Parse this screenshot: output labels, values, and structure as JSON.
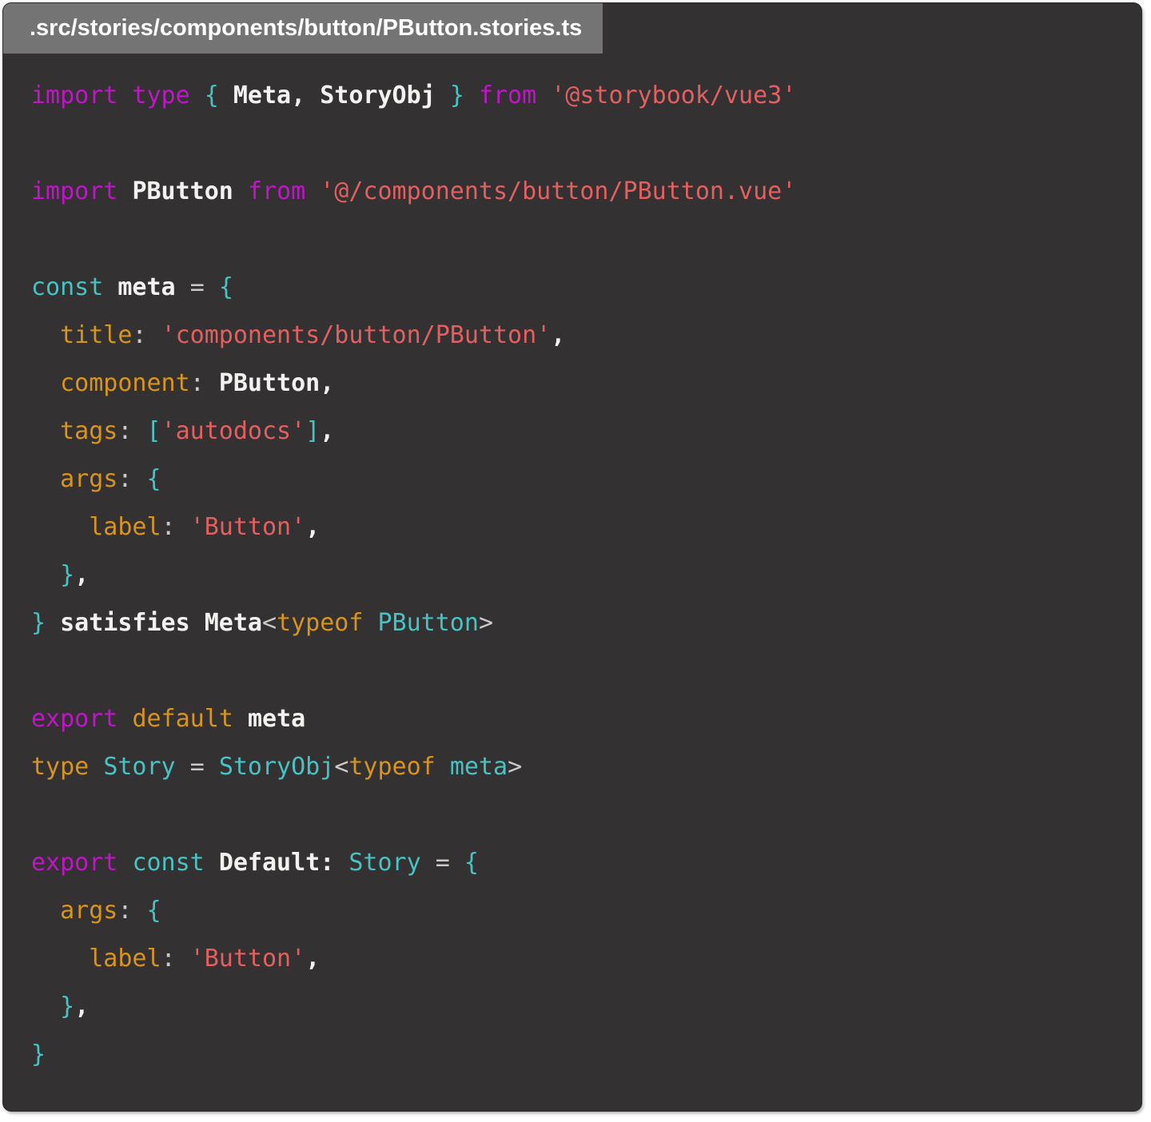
{
  "tab": {
    "filename": ".src/stories/components/button/PButton.stories.ts"
  },
  "colors": {
    "page_bg": "#ffffff",
    "window_bg": "#333132",
    "tab_bg": "#747474",
    "tab_text": "#ffffff",
    "keyword": "#c016c8",
    "cyan": "#48c2c2",
    "orange": "#d9941c",
    "string": "#e26060",
    "bold_text": "#f4f1f1",
    "punct": "#cbcbcb"
  },
  "code": {
    "language": "typescript",
    "lines": [
      [
        {
          "t": "import type ",
          "c": "kw"
        },
        {
          "t": "{ ",
          "c": "cy"
        },
        {
          "t": "Meta, StoryObj ",
          "c": "wb"
        },
        {
          "t": "} ",
          "c": "cy"
        },
        {
          "t": "from ",
          "c": "kw"
        },
        {
          "t": "'@storybook/vue3'",
          "c": "st"
        }
      ],
      [],
      [
        {
          "t": "import ",
          "c": "kw"
        },
        {
          "t": "PButton ",
          "c": "wb"
        },
        {
          "t": "from ",
          "c": "kw"
        },
        {
          "t": "'@/components/button/PButton.vue'",
          "c": "st"
        }
      ],
      [],
      [
        {
          "t": "const ",
          "c": "cy"
        },
        {
          "t": "meta ",
          "c": "wb"
        },
        {
          "t": "= ",
          "c": "pu"
        },
        {
          "t": "{",
          "c": "cy"
        }
      ],
      [
        {
          "t": "  title",
          "c": "or"
        },
        {
          "t": ": ",
          "c": "pu"
        },
        {
          "t": "'components/button/PButton'",
          "c": "st"
        },
        {
          "t": ",",
          "c": "wb"
        }
      ],
      [
        {
          "t": "  component",
          "c": "or"
        },
        {
          "t": ": ",
          "c": "pu"
        },
        {
          "t": "PButton,",
          "c": "wb"
        }
      ],
      [
        {
          "t": "  tags",
          "c": "or"
        },
        {
          "t": ": ",
          "c": "pu"
        },
        {
          "t": "[",
          "c": "cy"
        },
        {
          "t": "'autodocs'",
          "c": "st"
        },
        {
          "t": "]",
          "c": "cy"
        },
        {
          "t": ",",
          "c": "wb"
        }
      ],
      [
        {
          "t": "  args",
          "c": "or"
        },
        {
          "t": ": ",
          "c": "pu"
        },
        {
          "t": "{",
          "c": "cy"
        }
      ],
      [
        {
          "t": "    label",
          "c": "or"
        },
        {
          "t": ": ",
          "c": "pu"
        },
        {
          "t": "'Button'",
          "c": "st"
        },
        {
          "t": ",",
          "c": "wb"
        }
      ],
      [
        {
          "t": "  }",
          "c": "cy"
        },
        {
          "t": ",",
          "c": "wb"
        }
      ],
      [
        {
          "t": "} ",
          "c": "cy"
        },
        {
          "t": "satisfies Meta",
          "c": "wb"
        },
        {
          "t": "<",
          "c": "pu"
        },
        {
          "t": "typeof ",
          "c": "or"
        },
        {
          "t": "PButton",
          "c": "cy"
        },
        {
          "t": ">",
          "c": "pu"
        }
      ],
      [],
      [
        {
          "t": "export ",
          "c": "kw"
        },
        {
          "t": "default ",
          "c": "or"
        },
        {
          "t": "meta",
          "c": "wb"
        }
      ],
      [
        {
          "t": "type ",
          "c": "or"
        },
        {
          "t": "Story ",
          "c": "cy"
        },
        {
          "t": "= ",
          "c": "pu"
        },
        {
          "t": "StoryObj",
          "c": "cy"
        },
        {
          "t": "<",
          "c": "pu"
        },
        {
          "t": "typeof ",
          "c": "or"
        },
        {
          "t": "meta",
          "c": "cy"
        },
        {
          "t": ">",
          "c": "pu"
        }
      ],
      [],
      [
        {
          "t": "export ",
          "c": "kw"
        },
        {
          "t": "const ",
          "c": "cy"
        },
        {
          "t": "Default: ",
          "c": "wb"
        },
        {
          "t": "Story ",
          "c": "cy"
        },
        {
          "t": "= ",
          "c": "pu"
        },
        {
          "t": "{",
          "c": "cy"
        }
      ],
      [
        {
          "t": "  args",
          "c": "or"
        },
        {
          "t": ": ",
          "c": "pu"
        },
        {
          "t": "{",
          "c": "cy"
        }
      ],
      [
        {
          "t": "    label",
          "c": "or"
        },
        {
          "t": ": ",
          "c": "pu"
        },
        {
          "t": "'Button'",
          "c": "st"
        },
        {
          "t": ",",
          "c": "wb"
        }
      ],
      [
        {
          "t": "  }",
          "c": "cy"
        },
        {
          "t": ",",
          "c": "wb"
        }
      ],
      [
        {
          "t": "}",
          "c": "cy"
        }
      ]
    ]
  }
}
